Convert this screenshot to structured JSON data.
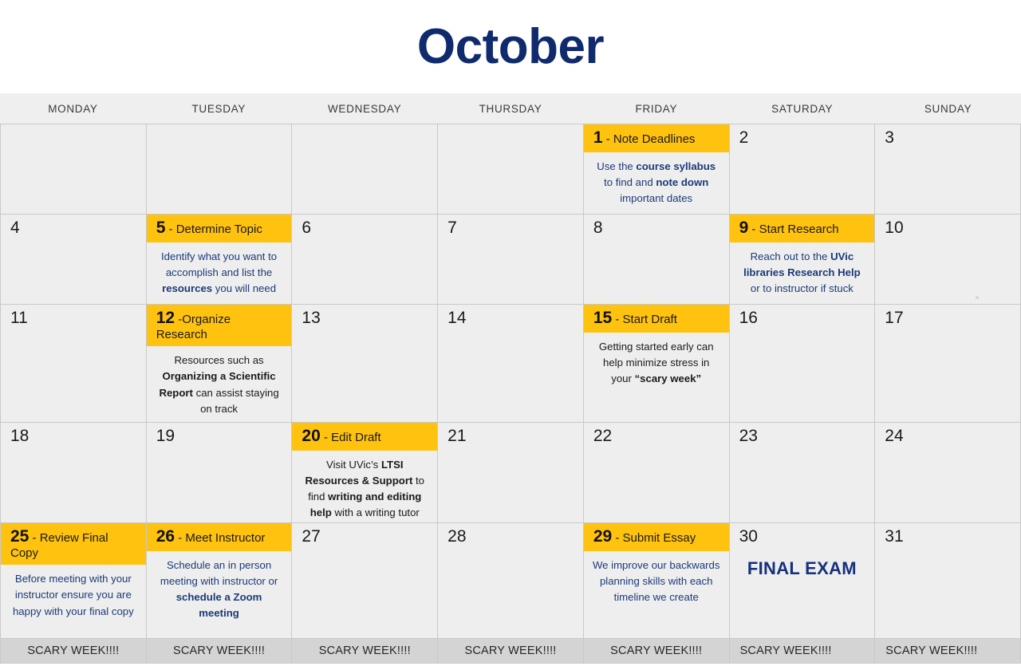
{
  "header": {
    "month_title": "October"
  },
  "weekdays": [
    "MONDAY",
    "TUESDAY",
    "WEDNESDAY",
    "THURSDAY",
    "FRIDAY",
    "SATURDAY",
    "SUNDAY"
  ],
  "colors": {
    "accent_yellow": "#FFC20E",
    "title_navy": "#102a6e",
    "body_navy": "#1b3a7a",
    "cell_bg": "#eeeeee",
    "header_bg": "#efefef",
    "scary_bg": "#d4d4d4",
    "border": "#c9c9c9"
  },
  "weeks": [
    {
      "days": [
        {
          "date": "",
          "type": "blank"
        },
        {
          "date": "",
          "type": "blank"
        },
        {
          "date": "",
          "type": "blank"
        },
        {
          "date": "",
          "type": "blank"
        },
        {
          "date": "1",
          "type": "event",
          "label": "- Note Deadlines",
          "body_color": "navy",
          "body_parts": [
            {
              "text": "Use the ",
              "bold": false
            },
            {
              "text": "course syllabus",
              "bold": true
            },
            {
              "text": " to find and ",
              "bold": false
            },
            {
              "text": "note down",
              "bold": true
            },
            {
              "text": " important dates",
              "bold": false
            }
          ]
        },
        {
          "date": "2",
          "type": "plain"
        },
        {
          "date": "3",
          "type": "plain"
        }
      ]
    },
    {
      "days": [
        {
          "date": "4",
          "type": "plain"
        },
        {
          "date": "5",
          "type": "event",
          "label": "- Determine Topic",
          "body_color": "navy",
          "body_parts": [
            {
              "text": "Identify what you want to accomplish and list the ",
              "bold": false
            },
            {
              "text": "resources",
              "bold": true
            },
            {
              "text": " you will need",
              "bold": false
            }
          ]
        },
        {
          "date": "6",
          "type": "plain"
        },
        {
          "date": "7",
          "type": "plain"
        },
        {
          "date": "8",
          "type": "plain"
        },
        {
          "date": "9",
          "type": "event",
          "label": "- Start Research",
          "body_color": "navy",
          "body_parts": [
            {
              "text": "Reach out to the ",
              "bold": false
            },
            {
              "text": "UVic libraries Research Help",
              "bold": true
            },
            {
              "text": " or to instructor if stuck",
              "bold": false
            }
          ]
        },
        {
          "date": "10",
          "type": "plain"
        }
      ]
    },
    {
      "days": [
        {
          "date": "11",
          "type": "plain"
        },
        {
          "date": "12",
          "type": "event",
          "label": "-Organize Research",
          "body_color": "black",
          "body_parts": [
            {
              "text": "Resources such as ",
              "bold": false
            },
            {
              "text": "Organizing a Scientific Report",
              "bold": true
            },
            {
              "text": " can assist staying on track",
              "bold": false
            }
          ]
        },
        {
          "date": "13",
          "type": "plain"
        },
        {
          "date": "14",
          "type": "plain"
        },
        {
          "date": "15",
          "type": "event",
          "label": "- Start Draft",
          "body_color": "black",
          "body_parts": [
            {
              "text": "Getting started early can help minimize stress in your ",
              "bold": false
            },
            {
              "text": "“scary week”",
              "bold": true
            }
          ]
        },
        {
          "date": "16",
          "type": "plain"
        },
        {
          "date": "17",
          "type": "plain"
        }
      ]
    },
    {
      "days": [
        {
          "date": "18",
          "type": "plain"
        },
        {
          "date": "19",
          "type": "plain"
        },
        {
          "date": "20",
          "type": "event",
          "label": "- Edit Draft",
          "body_color": "black",
          "body_parts": [
            {
              "text": "Visit UVic’s ",
              "bold": false
            },
            {
              "text": "LTSI Resources & Support",
              "bold": true
            },
            {
              "text": " to find ",
              "bold": false
            },
            {
              "text": "writing and editing help",
              "bold": true
            },
            {
              "text": " with a writing tutor",
              "bold": false
            }
          ]
        },
        {
          "date": "21",
          "type": "plain"
        },
        {
          "date": "22",
          "type": "plain"
        },
        {
          "date": "23",
          "type": "plain"
        },
        {
          "date": "24",
          "type": "plain"
        }
      ]
    },
    {
      "days": [
        {
          "date": "25",
          "type": "event",
          "label": "- Review Final Copy",
          "body_color": "navy",
          "body_parts": [
            {
              "text": "Before meeting with your instructor ensure you are happy with your final copy",
              "bold": false
            }
          ]
        },
        {
          "date": "26",
          "type": "event",
          "label": "- Meet Instructor",
          "body_color": "navy",
          "body_parts": [
            {
              "text": "Schedule an in person meeting with instructor or ",
              "bold": false
            },
            {
              "text": "schedule a Zoom meeting",
              "bold": true
            }
          ]
        },
        {
          "date": "27",
          "type": "plain"
        },
        {
          "date": "28",
          "type": "plain"
        },
        {
          "date": "29",
          "type": "event",
          "label": "- Submit Essay",
          "body_color": "navy",
          "body_parts": [
            {
              "text": "We improve our backwards planning skills with each timeline we create",
              "bold": false
            }
          ]
        },
        {
          "date": "30",
          "type": "plain",
          "note": "FINAL EXAM"
        },
        {
          "date": "31",
          "type": "plain"
        }
      ]
    }
  ],
  "scary_week": {
    "label": "SCARY WEEK!!!!",
    "cells": [
      {
        "label": "SCARY WEEK!!!!",
        "align": "center"
      },
      {
        "label": "SCARY WEEK!!!!",
        "align": "center"
      },
      {
        "label": "SCARY WEEK!!!!",
        "align": "center"
      },
      {
        "label": "SCARY WEEK!!!!",
        "align": "center"
      },
      {
        "label": "SCARY WEEK!!!!",
        "align": "center"
      },
      {
        "label": "SCARY WEEK!!!!",
        "align": "left"
      },
      {
        "label": "SCARY WEEK!!!!",
        "align": "left"
      }
    ]
  }
}
